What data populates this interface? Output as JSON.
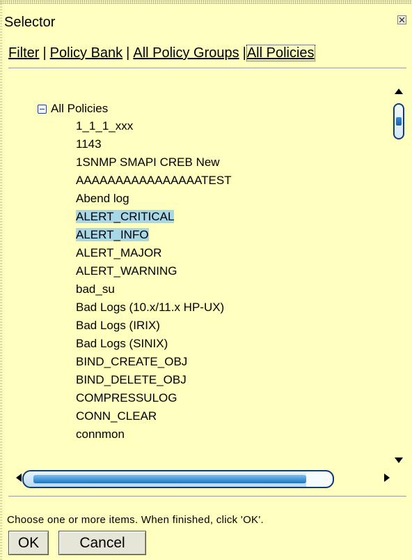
{
  "dialog": {
    "title": "Selector"
  },
  "tabs": {
    "filter": "Filter",
    "policy_bank": "Policy Bank",
    "all_policy_groups": "All Policy Groups",
    "all_policies": "All Policies",
    "separator": "|",
    "active": "All Policies"
  },
  "tree": {
    "root_label": "All Policies",
    "items": [
      {
        "label": "1_1_1_xxx",
        "selected": false
      },
      {
        "label": "1143",
        "selected": false
      },
      {
        "label": "1SNMP SMAPI CREB New",
        "selected": false
      },
      {
        "label": "AAAAAAAAAAAAAAAATEST",
        "selected": false
      },
      {
        "label": "Abend log",
        "selected": false
      },
      {
        "label": "ALERT_CRITICAL",
        "selected": true
      },
      {
        "label": "ALERT_INFO",
        "selected": true
      },
      {
        "label": "ALERT_MAJOR",
        "selected": false
      },
      {
        "label": "ALERT_WARNING",
        "selected": false
      },
      {
        "label": "bad_su",
        "selected": false
      },
      {
        "label": "Bad Logs (10.x/11.x HP-UX)",
        "selected": false
      },
      {
        "label": "Bad Logs (IRIX)",
        "selected": false
      },
      {
        "label": "Bad Logs (SINIX)",
        "selected": false
      },
      {
        "label": "BIND_CREATE_OBJ",
        "selected": false
      },
      {
        "label": "BIND_DELETE_OBJ",
        "selected": false
      },
      {
        "label": "COMPRESSULOG",
        "selected": false
      },
      {
        "label": "CONN_CLEAR",
        "selected": false
      },
      {
        "label": "connmon",
        "selected": false
      }
    ]
  },
  "footer": {
    "instructions": "Choose one or more items. When finished, click 'OK'.",
    "ok_label": "OK",
    "cancel_label": "Cancel"
  },
  "colors": {
    "background": "#ffffbf",
    "selection": "#a8d8e8",
    "scroll_thumb_border": "#0e3d78"
  }
}
